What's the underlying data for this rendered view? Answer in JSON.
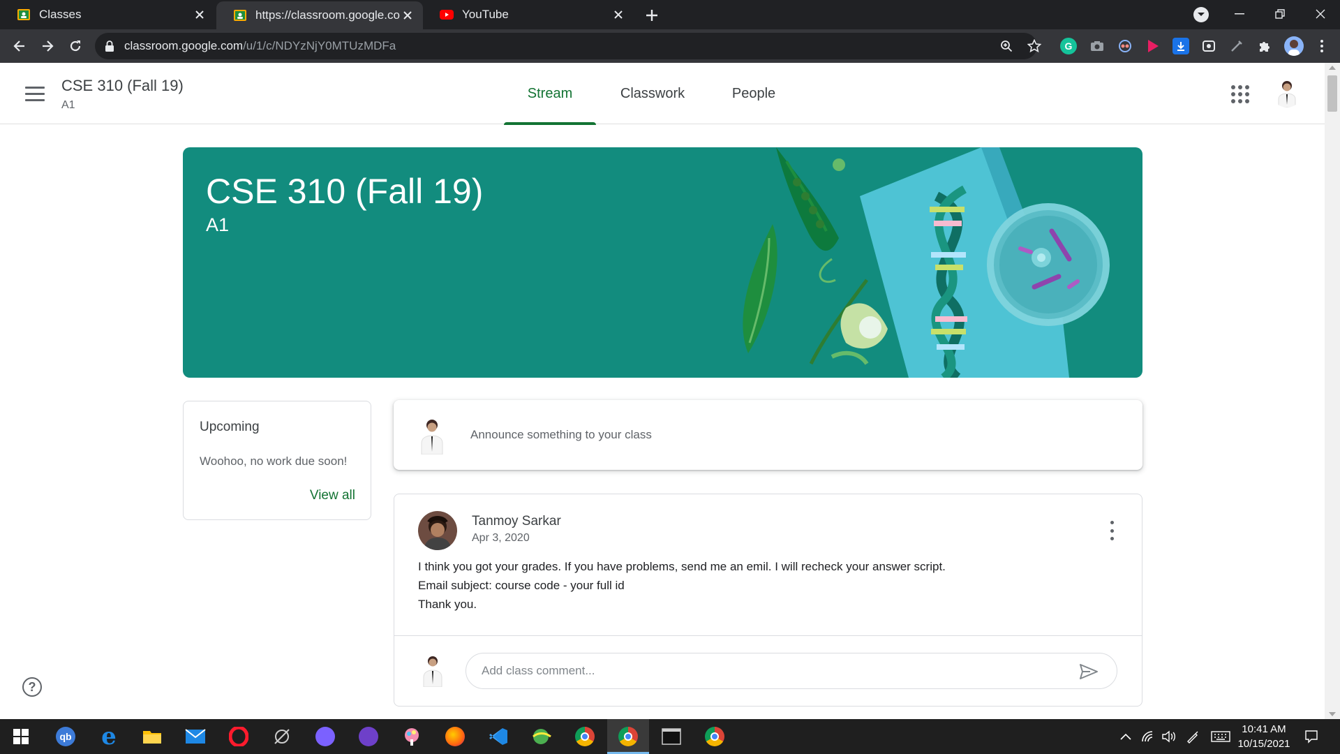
{
  "browser": {
    "tabs": [
      {
        "label": "Classes",
        "active": false
      },
      {
        "label": "https://classroom.google.com/u/",
        "active": true
      },
      {
        "label": "YouTube",
        "active": false
      }
    ],
    "url_host": "classroom.google.com",
    "url_path": "/u/1/c/NDYzNjY0MTUzMDFa"
  },
  "header": {
    "class_title": "CSE 310 (Fall 19)",
    "class_section": "A1",
    "tabs": [
      {
        "label": "Stream",
        "active": true
      },
      {
        "label": "Classwork",
        "active": false
      },
      {
        "label": "People",
        "active": false
      }
    ]
  },
  "banner": {
    "title": "CSE 310 (Fall 19)",
    "section": "A1",
    "color": "#128c7e"
  },
  "upcoming": {
    "title": "Upcoming",
    "message": "Woohoo, no work due soon!",
    "view_all": "View all"
  },
  "announce": {
    "placeholder": "Announce something to your class"
  },
  "post": {
    "author": "Tanmoy Sarkar",
    "date": "Apr 3, 2020",
    "lines": [
      "I think you got your grades. If you have problems, send me an emil. I will recheck your answer script.",
      "Email subject: course code - your full id",
      "Thank you."
    ],
    "comment_placeholder": "Add class comment..."
  },
  "taskbar": {
    "time": "10:41 AM",
    "date": "10/15/2021"
  },
  "colors": {
    "accent": "#137333",
    "banner": "#128c7e"
  }
}
